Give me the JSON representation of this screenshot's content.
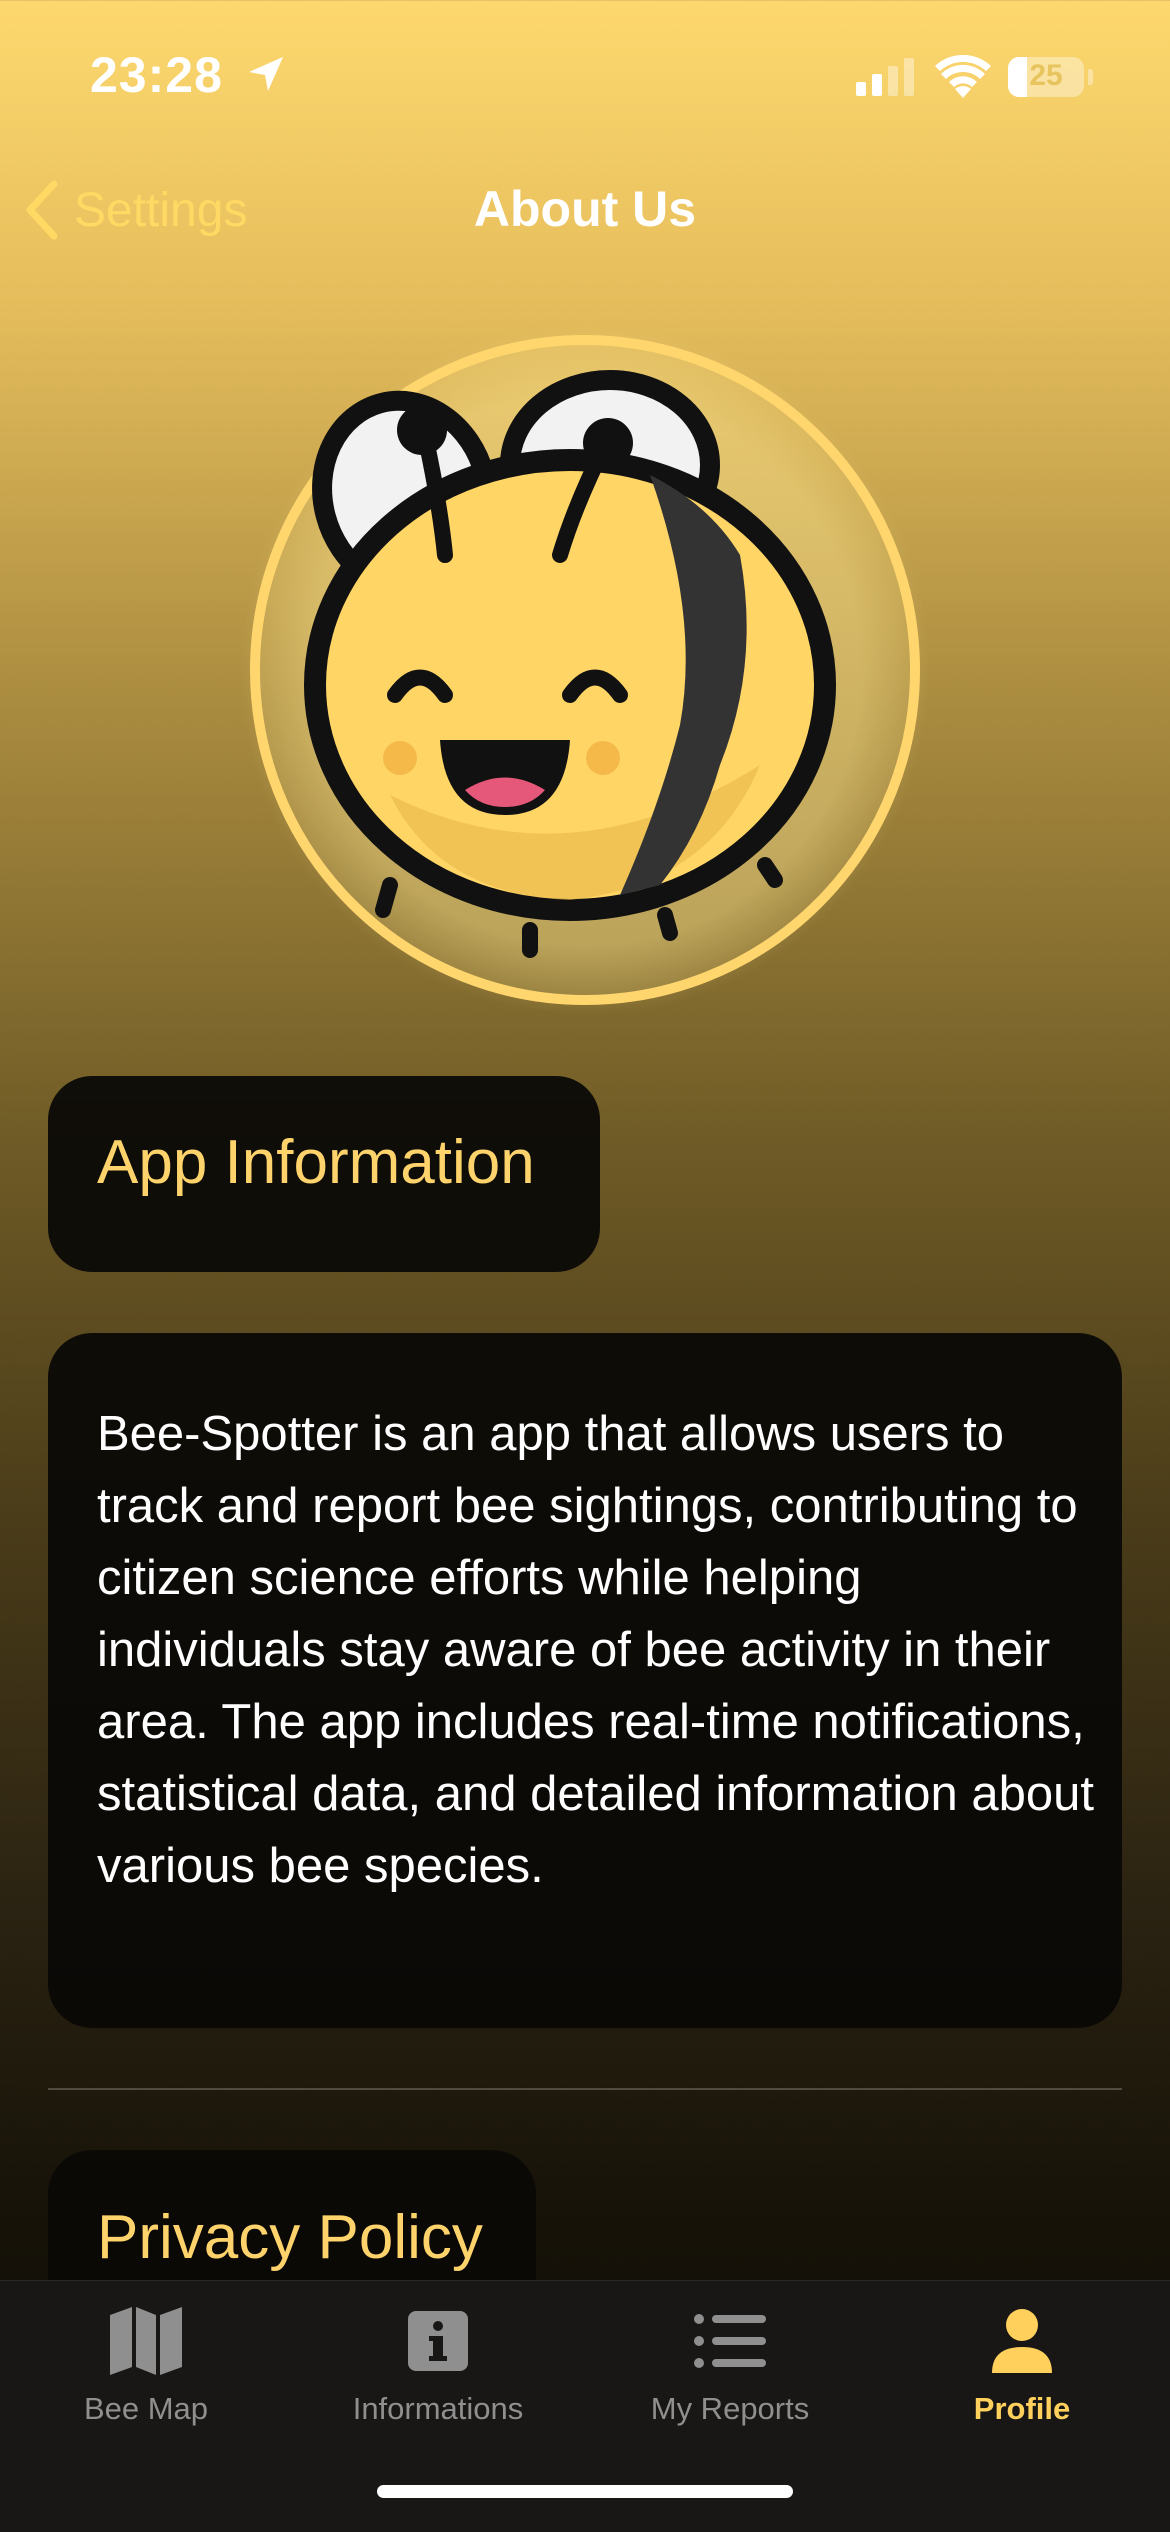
{
  "status_bar": {
    "time": "23:28",
    "battery_level": "25",
    "battery_fraction": 0.25
  },
  "nav": {
    "back_label": "Settings",
    "title": "About Us"
  },
  "sections": {
    "app_information_title": "App Information",
    "app_description": "Bee-Spotter is an app that allows users to track and report bee sightings, contributing to citizen science efforts while helping individuals stay aware of bee activity in their area. The app includes real-time notifications, statistical data, and detailed information about various bee species.",
    "privacy_policy_title": "Privacy Policy"
  },
  "tab_bar": {
    "items": [
      {
        "label": "Bee Map",
        "icon": "map-icon",
        "active": false
      },
      {
        "label": "Informations",
        "icon": "info-icon",
        "active": false
      },
      {
        "label": "My Reports",
        "icon": "list-icon",
        "active": false
      },
      {
        "label": "Profile",
        "icon": "person-icon",
        "active": true
      }
    ]
  },
  "colors": {
    "accent": "#ffd15c",
    "title_yellow": "#ffd36b",
    "card_background": "#0a0906",
    "tab_inactive": "#8f8f8f",
    "tab_bar_background": "#181715"
  }
}
